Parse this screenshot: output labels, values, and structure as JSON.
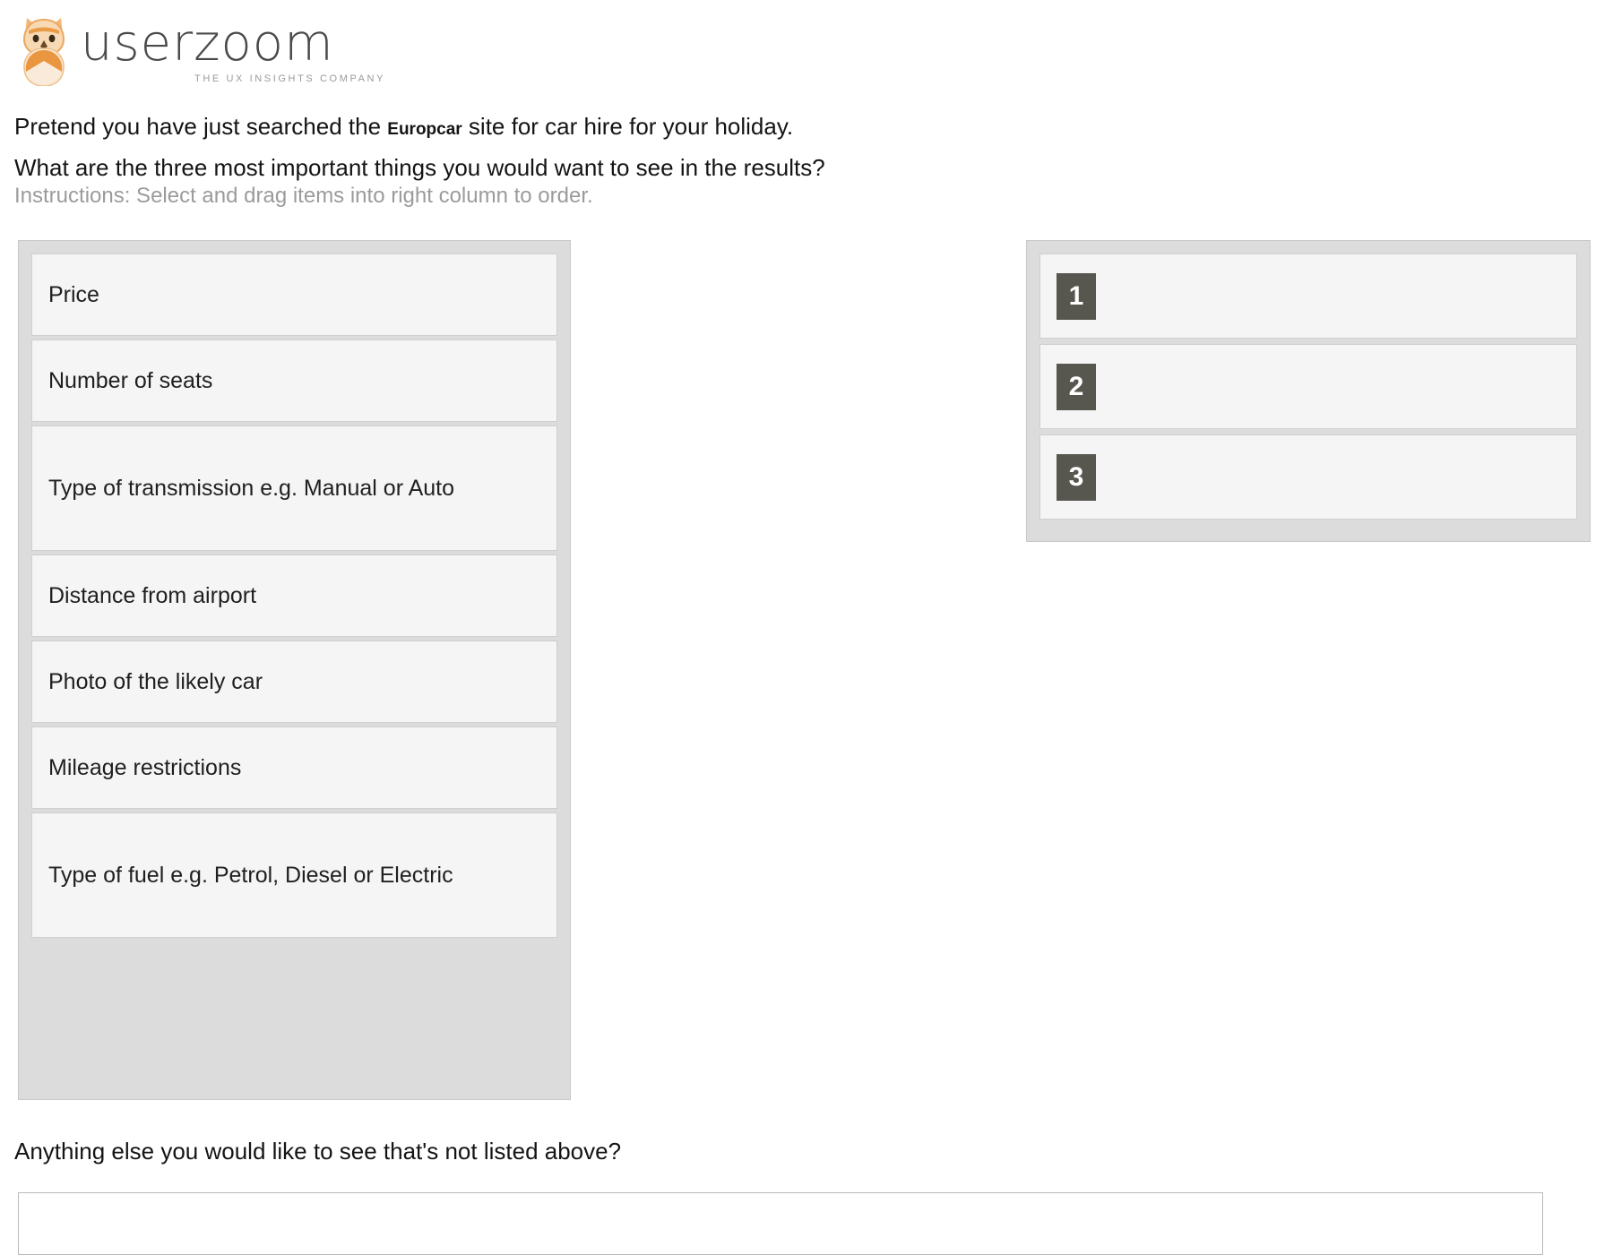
{
  "brand": {
    "logo_icon": "owl-icon",
    "name": "userzoom",
    "tagline": "THE UX INSIGHTS COMPANY",
    "owl_color": "#e8933f",
    "wordmark_color": "#4a4a4a"
  },
  "question": {
    "line1_before": "Pretend you have just searched the ",
    "line1_brand": "Europcar",
    "line1_after": " site for car hire for your holiday.",
    "line2": "What are the three most important things you would want to see in the results?",
    "instructions": "Instructions: Select and drag items into right column to order."
  },
  "source_column": {
    "items": [
      {
        "label": "Price"
      },
      {
        "label": "Number of seats"
      },
      {
        "label": "Type of transmission e.g. Manual or Auto"
      },
      {
        "label": "Distance from airport"
      },
      {
        "label": "Photo of the likely car"
      },
      {
        "label": "Mileage restrictions"
      },
      {
        "label": "Type of fuel e.g. Petrol, Diesel or Electric"
      }
    ]
  },
  "target_column": {
    "slots": [
      {
        "number": "1",
        "value": ""
      },
      {
        "number": "2",
        "value": ""
      },
      {
        "number": "3",
        "value": ""
      }
    ],
    "badge_color": "#57564f"
  },
  "followup": {
    "label": "Anything else you would like to see that's not listed above?",
    "value": "",
    "placeholder": ""
  },
  "colors": {
    "panel_background": "#dcdcdc",
    "card_background": "#f5f5f5",
    "card_border": "#cfcfcf",
    "muted_text": "#9b9b9b",
    "body_text": "#141414"
  }
}
